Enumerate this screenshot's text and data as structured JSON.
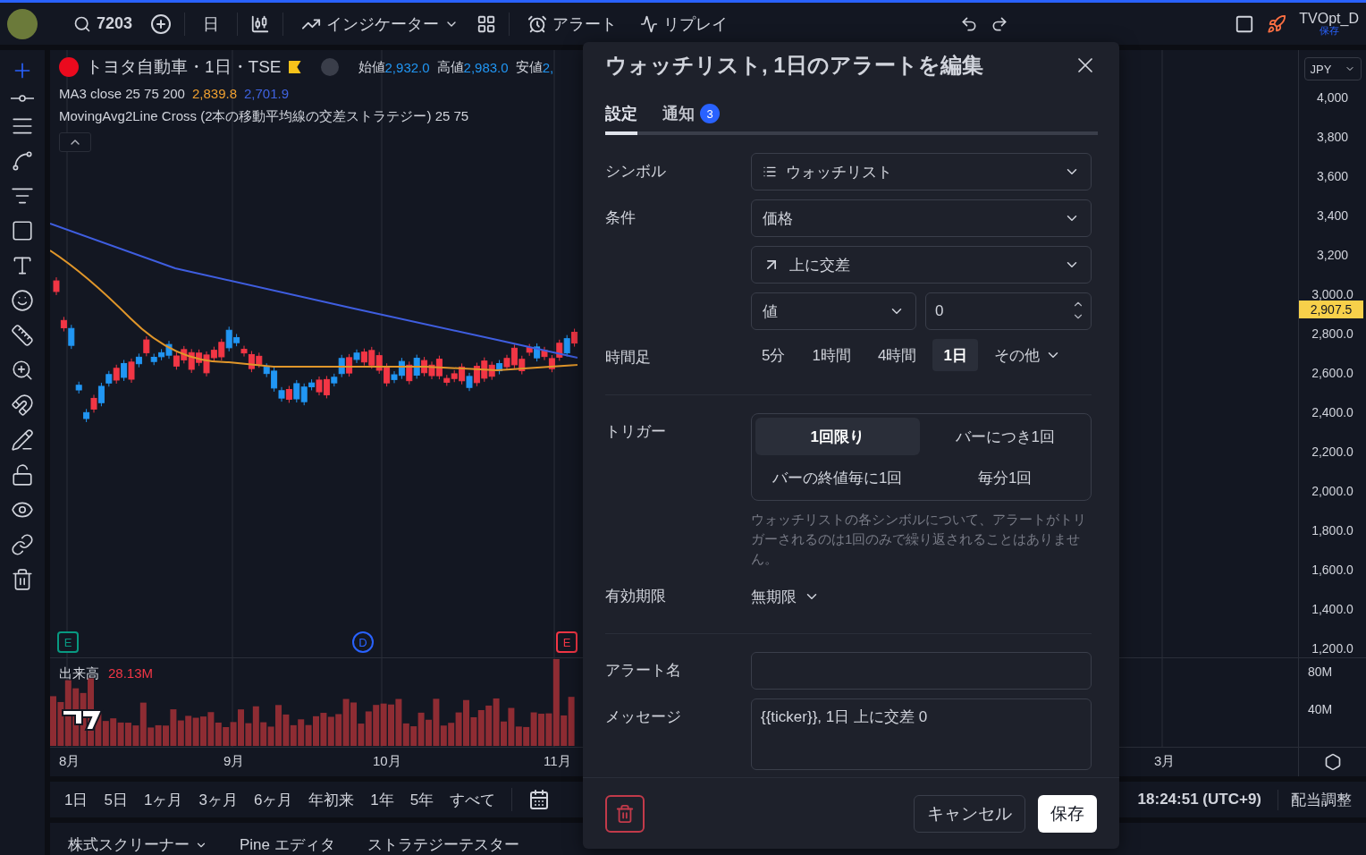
{
  "toolbar": {
    "symbol": "7203",
    "interval": "日",
    "indicators": "インジケーター",
    "alert": "アラート",
    "replay": "リプレイ",
    "user": "TVOpt_D",
    "save": "保存"
  },
  "legend": {
    "title": "トヨタ自動車・1日・TSE",
    "ohlc": [
      {
        "label": "始値",
        "value": "2,932.0"
      },
      {
        "label": "高値",
        "value": "2,983.0"
      },
      {
        "label": "安値",
        "value": "2,"
      }
    ],
    "ma_name": "MA3 close 25 75 200",
    "ma_values": [
      {
        "text": "2,839.8",
        "color": "#f0a030"
      },
      {
        "text": "2,701.9",
        "color": "#3f63e0"
      }
    ],
    "strategy": "MovingAvg2Line Cross (2本の移動平均線の交差ストラテジー) 25 75"
  },
  "markers": [
    {
      "label": "E",
      "color": "#089981"
    },
    {
      "label": "D",
      "color": "#2962ff"
    },
    {
      "label": "E",
      "color": "#f23645"
    }
  ],
  "volume": {
    "label": "出来高",
    "value": "28.13M"
  },
  "price_axis": {
    "currency": "JPY",
    "ticks": [
      "4,000",
      "3,800",
      "3,600",
      "3,400",
      "3,200",
      "3,000.0",
      "2,800.0",
      "2,600.0",
      "2,400.0",
      "2,200.0",
      "2,000.0",
      "1,800.0",
      "1,600.0",
      "1,400.0",
      "1,200.0"
    ],
    "last_price": "2,907.5"
  },
  "volume_axis": [
    "80M",
    "40M"
  ],
  "time_axis": [
    "8月",
    "9月",
    "10月",
    "11月",
    "3月"
  ],
  "ranges": [
    "1日",
    "5日",
    "1ヶ月",
    "3ヶ月",
    "6ヶ月",
    "年初来",
    "1年",
    "5年",
    "すべて"
  ],
  "status": {
    "time": "18:24:51 (UTC+9)",
    "adjust": "配当調整"
  },
  "bottom_tabs": [
    "株式スクリーナー",
    "Pine エディタ",
    "ストラテジーテスター"
  ],
  "dialog": {
    "title": "ウォッチリスト, 1日のアラートを編集",
    "tabs": [
      {
        "label": "設定",
        "selected": true
      },
      {
        "label": "通知",
        "badge": "3",
        "selected": false
      }
    ],
    "symbol": {
      "label": "シンボル",
      "value": "ウォッチリスト"
    },
    "condition": {
      "label": "条件",
      "source": "価格",
      "operator": "上に交差",
      "type": "値",
      "value": "0"
    },
    "timeframe": {
      "label": "時間足",
      "options": [
        {
          "label": "5分",
          "selected": false
        },
        {
          "label": "1時間",
          "selected": false
        },
        {
          "label": "4時間",
          "selected": false
        },
        {
          "label": "1日",
          "selected": true
        }
      ],
      "more": "その他"
    },
    "trigger": {
      "label": "トリガー",
      "options": [
        {
          "label": "1回限り",
          "selected": true
        },
        {
          "label": "バーにつき1回",
          "selected": false
        },
        {
          "label": "バーの終値毎に1回",
          "selected": false
        },
        {
          "label": "毎分1回",
          "selected": false
        }
      ],
      "hint": "ウォッチリストの各シンボルについて、アラートがトリガーされるのは1回のみで繰り返されることはありません。"
    },
    "expiry": {
      "label": "有効期限",
      "value": "無期限"
    },
    "alert_name": {
      "label": "アラート名"
    },
    "message": {
      "label": "メッセージ",
      "value": "{{ticker}}, 1日 上に交差 0"
    },
    "cancel": "キャンセル",
    "save": "保存"
  }
}
